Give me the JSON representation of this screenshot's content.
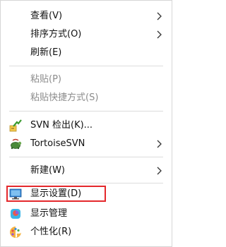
{
  "menu": {
    "view": "查看(V)",
    "sort": "排序方式(O)",
    "refresh": "刷新(E)",
    "paste": "粘贴(P)",
    "paste_shortcut": "粘贴快捷方式(S)",
    "svn_checkout": "SVN 检出(K)...",
    "tortoise": "TortoiseSVN",
    "new": "新建(W)",
    "display_settings": "显示设置(D)",
    "display_manage": "显示管理",
    "personalize": "个性化(R)"
  },
  "colors": {
    "highlight_border": "#e4282c",
    "disabled_text": "#8c8c8c"
  }
}
